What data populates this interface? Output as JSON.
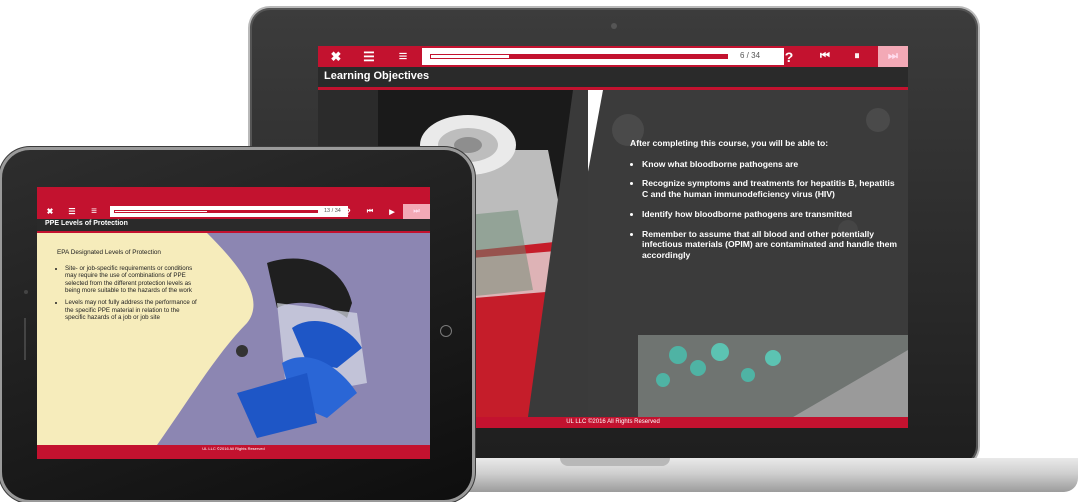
{
  "laptop": {
    "toolbar": {
      "close_glyph": "✖",
      "menu_glyph": "☰",
      "list_glyph": "≡",
      "page_indicator": "6 / 34",
      "progress_fraction": 0.27,
      "help_glyph": "?",
      "rewind_glyph": "⏮",
      "pause_glyph": "⏸",
      "forward_glyph": "⏭"
    },
    "slide_title": "Learning Objectives",
    "intro": "After completing this course, you will be able to:",
    "objectives": [
      "Know what bloodborne pathogens are",
      "Recognize symptoms and treatments for hepatitis B, hepatitis C and the human immunodeficiency virus (HIV)",
      "Identify how bloodborne pathogens are transmitted",
      "Remember to assume that all blood and other potentially infectious materials (OPIM) are contaminated and handle them accordingly"
    ],
    "footer": "UL LLC ©2016 All Rights Reserved"
  },
  "tablet": {
    "toolbar": {
      "close_glyph": "✖",
      "menu_glyph": "☰",
      "list_glyph": "≡",
      "page_indicator": "13 / 34",
      "progress_fraction": 0.46,
      "help_glyph": "?",
      "rewind_glyph": "⏮",
      "play_glyph": "▶",
      "forward_glyph": "⏭"
    },
    "slide_title": "PPE Levels of Protection",
    "heading": "EPA Designated Levels of Protection",
    "bullets": [
      "Site- or job-specific requirements or conditions may require the use of combinations of PPE selected from the different protection levels as being more suitable to the hazards of the work",
      "Levels may not fully address the performance of the specific PPE material in relation to the specific hazards of a job or job site"
    ],
    "footer": "UL LLC ©2016 All Rights Reserved"
  },
  "colors": {
    "accent": "#c3122f",
    "slide_dark": "#2a2a2a",
    "tablet_bg": "#f6ecbb",
    "tablet_purple": "#8c86b2"
  }
}
